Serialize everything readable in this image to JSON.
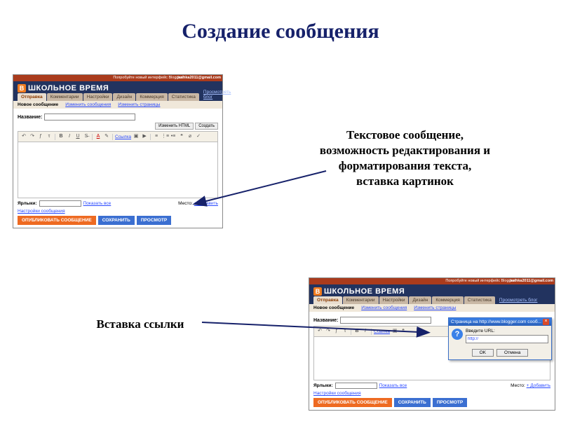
{
  "title": "Создание сообщения",
  "annot1": "Текстовое сообщение, возможность редактирования и форматирования текста, вставка картинок",
  "annot2": "Вставка ссылки",
  "common": {
    "try_new": "Попробуйте новый интерфейс Blogger!",
    "email": "tashka2011@gmail.com",
    "logo_b": "B",
    "blog_name": "ШКОЛЬНОЕ ВРЕМЯ",
    "tabs": {
      "send": "Отправка",
      "comments": "Комментарии",
      "settings": "Настройки",
      "design": "Дизайн",
      "commerce": "Коммерция",
      "stats": "Статистика",
      "view": "Просмотреть блог"
    },
    "sub": {
      "new": "Новое сообщение",
      "edit": "Изменить сообщения",
      "pages": "Изменить страницы"
    },
    "title_label": "Название:",
    "html_btn": "Изменить HTML",
    "compose_btn": "Создать",
    "toolbar_link": "Ссылка",
    "tags_label": "Ярлыки:",
    "show_all": "Показать все",
    "place_label": "Место:",
    "add_place": "+ Добавить",
    "post_settings": "Настройки сообщения",
    "publish": "ОПУБЛИКОВАТЬ СООБЩЕНИЕ",
    "save": "СОХРАНИТЬ",
    "preview": "ПРОСМОТР"
  },
  "dialog": {
    "titlebar": "Страница на http://www.blogger.com сооб...",
    "label": "Введите URL:",
    "value": "http://",
    "ok": "OK",
    "cancel": "Отмена"
  }
}
